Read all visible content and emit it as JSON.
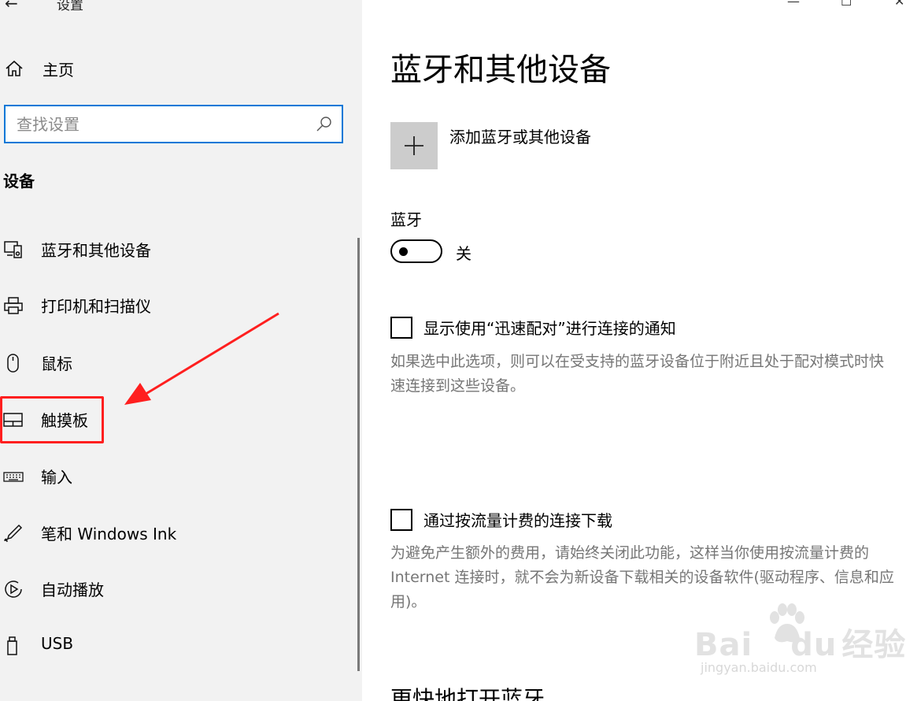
{
  "window": {
    "title": "设置",
    "back_glyph": "←",
    "controls": [
      "—",
      "☐",
      "✕"
    ]
  },
  "sidebar": {
    "home_label": "主页",
    "search_placeholder": "查找设置",
    "section_title": "设备",
    "items": [
      {
        "label": "蓝牙和其他设备",
        "icon": "bluetooth-devices-icon"
      },
      {
        "label": "打印机和扫描仪",
        "icon": "printer-icon"
      },
      {
        "label": "鼠标",
        "icon": "mouse-icon"
      },
      {
        "label": "触摸板",
        "icon": "touchpad-icon"
      },
      {
        "label": "输入",
        "icon": "keyboard-icon"
      },
      {
        "label": "笔和 Windows Ink",
        "icon": "pen-icon"
      },
      {
        "label": "自动播放",
        "icon": "autoplay-icon"
      },
      {
        "label": "USB",
        "icon": "usb-icon"
      }
    ],
    "highlighted_item": "触摸板"
  },
  "main": {
    "title": "蓝牙和其他设备",
    "add_device_label": "添加蓝牙或其他设备",
    "bluetooth_label": "蓝牙",
    "bluetooth_state": "关",
    "swift_pair": {
      "label": "显示使用“迅速配对”进行连接的通知",
      "description": "如果选中此选项，则可以在受支持的蓝牙设备位于附近且处于配对模式时快速连接到这些设备。"
    },
    "metered": {
      "label": "通过按流量计费的连接下载",
      "description": "为避免产生额外的费用，请始终关闭此功能，这样当你使用按流量计费的 Internet 连接时，就不会为新设备下载相关的设备软件(驱动程序、信息和应用)。"
    },
    "next_section_title": "更快地打开蓝牙"
  },
  "watermark": {
    "text": "Bai",
    "text2": "du",
    "text3": "经验",
    "sub": "jingyan.baidu.com"
  },
  "colors": {
    "accent": "#0078d7",
    "annotation": "#ff1f1f",
    "sidebar_bg": "#f2f2f2"
  }
}
